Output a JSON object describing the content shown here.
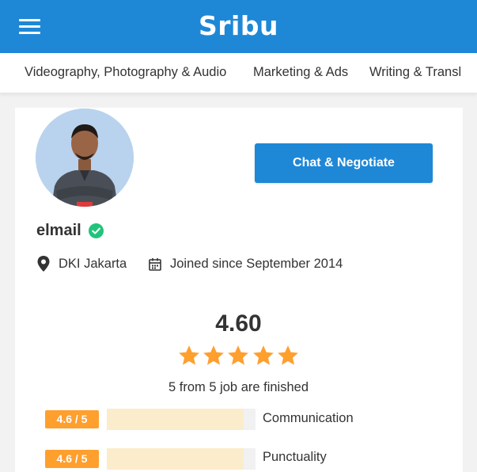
{
  "header": {
    "logo_text": "Sribu",
    "brand_color": "#1e88d6",
    "menu_icon": "hamburger-menu-icon"
  },
  "categories": [
    "Videography, Photography & Audio",
    "Marketing & Ads",
    "Writing & Transl"
  ],
  "profile": {
    "username": "elmail",
    "verified": true,
    "location": "DKI Jakarta",
    "joined": "Joined since September 2014",
    "chat_button": "Chat & Negotiate"
  },
  "rating": {
    "value": "4.60",
    "stars": 5,
    "jobs_text": "5 from 5 job are finished",
    "star_color": "#ff9f2e",
    "metrics": [
      {
        "score": "4.6 / 5",
        "label": "Communication",
        "fraction": 0.92
      },
      {
        "score": "4.6 / 5",
        "label": "Punctuality",
        "fraction": 0.92
      }
    ]
  }
}
